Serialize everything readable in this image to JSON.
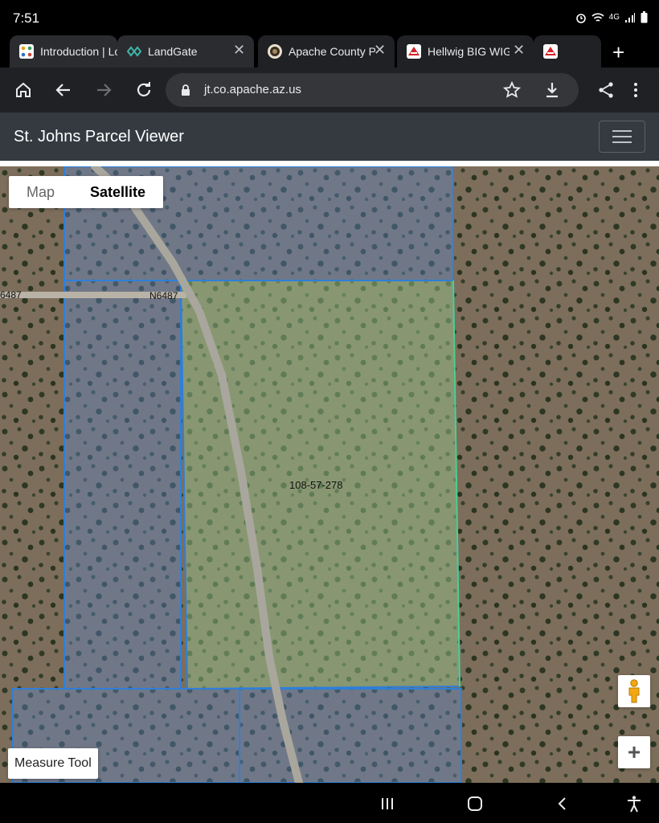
{
  "status_bar": {
    "time": "7:51",
    "network": "4G"
  },
  "tabs": [
    {
      "title": "Introduction | Lo",
      "closable": false
    },
    {
      "title": "LandGate",
      "closable": true
    },
    {
      "title": "Apache County Par",
      "closable": true
    },
    {
      "title": "Hellwig BIG WIG A",
      "closable": true
    },
    {
      "title": "",
      "closable": false
    }
  ],
  "toolbar": {
    "url": "jt.co.apache.az.us"
  },
  "app": {
    "title": "St. Johns Parcel Viewer"
  },
  "map": {
    "type_options": [
      "Map",
      "Satellite"
    ],
    "selected_type": "Satellite",
    "road_labels": [
      "6487",
      "N6487"
    ],
    "parcel_label": "108-57-278",
    "measure_tool_label": "Measure Tool",
    "zoom_in_label": "+"
  }
}
